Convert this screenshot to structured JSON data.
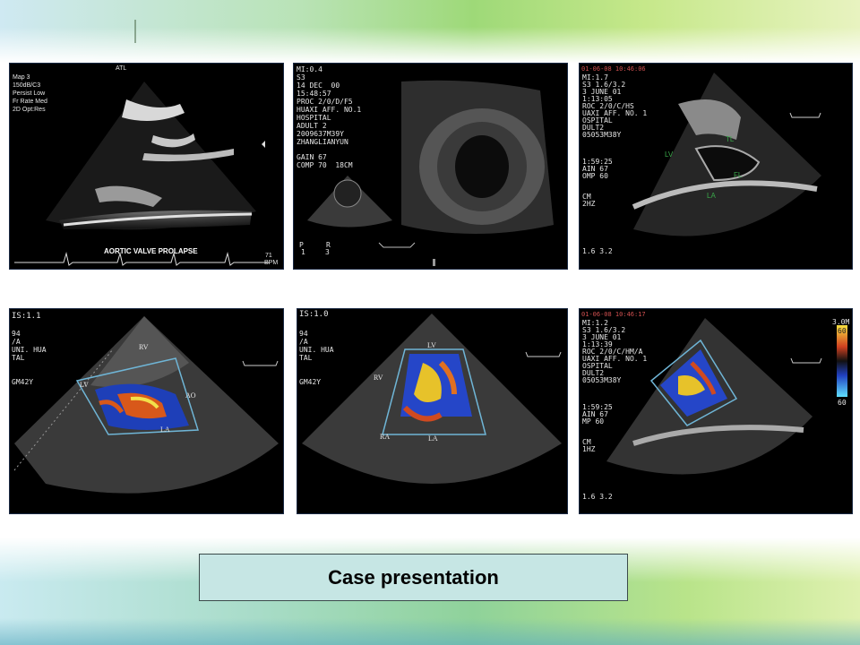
{
  "slide": {
    "title": "Case presentation",
    "colors": {
      "title_box": "#c6e6e4",
      "accent_green": "#9ed978",
      "accent_blue": "#a8dcc8"
    }
  },
  "panels": [
    {
      "id": "p1",
      "logo": "ATL",
      "settings": [
        "Map 3",
        "150dB/C3",
        "Persist Low",
        "Fr Rate Med",
        "2D Opt:Res"
      ],
      "caption": "AORTIC VALVE PROLAPSE",
      "hr_value": "71",
      "hr_unit": "BPM"
    },
    {
      "id": "p2",
      "header": [
        "MI:0.4",
        "S3",
        "14 DEC  00",
        "15:48:57",
        "PROC 2/0/D/F5",
        "HUAXI AFF. NO.1",
        "HOSPITAL",
        "ADULT 2",
        "2009637M39Y",
        "ZHANGLIANYUN"
      ],
      "gain": [
        "GAIN 67",
        "COMP 70  18CM"
      ],
      "probe_marks": [
        "P",
        "R",
        "1",
        "3"
      ]
    },
    {
      "id": "p3",
      "date_line": "01-06-08 10:46:06",
      "header": [
        "MI:1.7",
        "S3 1.6/3.2",
        "3 JUNE 01",
        "1:13:05",
        "ROC 2/0/C/HS",
        "UAXI AFF. NO. 1",
        "OSPITAL",
        "DULT2",
        "05053M38Y"
      ],
      "mid": [
        "1:59:25",
        "AIN 67",
        "OMP 60"
      ],
      "lower": [
        "CM",
        "2HZ"
      ],
      "labels": [
        "TL",
        "LV",
        "FL",
        "LA"
      ],
      "probe": "1.6 3.2"
    },
    {
      "id": "p4",
      "header": [
        "IS:1.1",
        "",
        "94",
        "/A",
        "UNI. HUA",
        "TAL",
        "",
        "GM42Y"
      ],
      "labels": [
        "RV",
        "LV",
        "AO",
        "LA"
      ]
    },
    {
      "id": "p5",
      "header": [
        "IS:1.0",
        "",
        "94",
        "/A",
        "UNI. HUA",
        "TAL",
        "",
        "GM42Y"
      ],
      "labels": [
        "LV",
        "RV",
        "RA",
        "LA"
      ]
    },
    {
      "id": "p6",
      "date_line": "01-06-08 10:46:17",
      "header": [
        "MI:1.2",
        "S3 1.6/3.2",
        "3 JUNE 01",
        "1:13:39",
        "ROC 2/0/C/HM/A",
        "UAXI AFF. NO. 1",
        "OSPITAL",
        "DULT2",
        "05053M38Y"
      ],
      "mid": [
        "1:59:25",
        "AIN 67",
        "MP 60"
      ],
      "lower": [
        "CM",
        "1HZ"
      ],
      "scale_top": "3.0M",
      "scale_vals": [
        "60",
        "60"
      ],
      "probe": "1.6 3.2"
    }
  ]
}
